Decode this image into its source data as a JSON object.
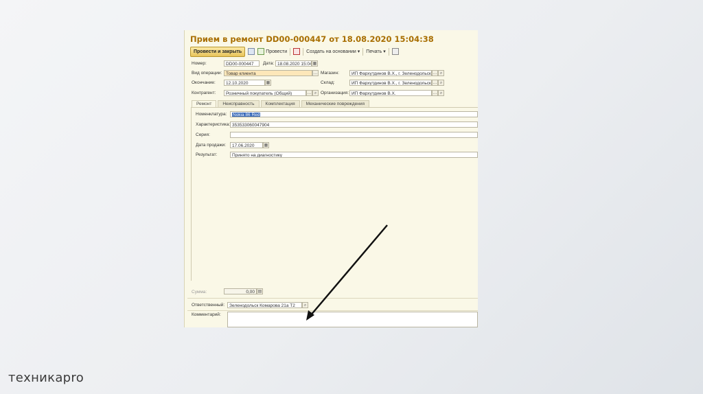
{
  "window": {
    "title": "Прием в ремонт DD00-000447 от 18.08.2020 15:04:38"
  },
  "toolbar": {
    "post_close": "Провести и закрыть",
    "post": "Провести",
    "create_based": "Создать на основании",
    "print": "Печать"
  },
  "header_fields": {
    "number_label": "Номер:",
    "number": "DD00-000447",
    "date_label": "Дата:",
    "date": "18.08.2020 15:04",
    "op_type_label": "Вид операции:",
    "op_type": "Товар клиента",
    "end_label": "Окончание:",
    "end": "12.10.2020",
    "contractor_label": "Контрагент:",
    "contractor": "Розничный покупатель (Общий)",
    "store_label": "Магазин:",
    "store": "ИП Фархутдинов В.Х., г. Зеленодольск",
    "warehouse_label": "Склад:",
    "warehouse": "ИП Фархутдинов В.Х., г. Зеленодольск",
    "org_label": "Организация:",
    "org": "ИП Фархутдинов В.Х."
  },
  "tabs": [
    "Ремонт",
    "Неисправность",
    "Комплектация",
    "Механические повреждения"
  ],
  "repair": {
    "nomenclature_label": "Номенклатура:",
    "nomenclature": "Nokia 86 Red",
    "characteristic_label": "Характеристика:",
    "characteristic": "353533060047904",
    "series_label": "Серия:",
    "series": "",
    "sale_date_label": "Дата продажи:",
    "sale_date": "17.06.2020",
    "result_label": "Результат:",
    "result": "Принято на диагностику"
  },
  "footer": {
    "sum_label": "Сумма:",
    "sum": "0,00",
    "responsible_label": "Ответственный:",
    "responsible": "Зеленодольск Комарова 21а Т2",
    "comment_label": "Комментарий:",
    "comment": ""
  },
  "slide": {
    "logo": "техникаpro"
  },
  "colors": {
    "title": "#a86e00",
    "window_bg": "#faf8e7",
    "accent_button": "#e8c45a",
    "highlight_field": "#fde7b9"
  }
}
